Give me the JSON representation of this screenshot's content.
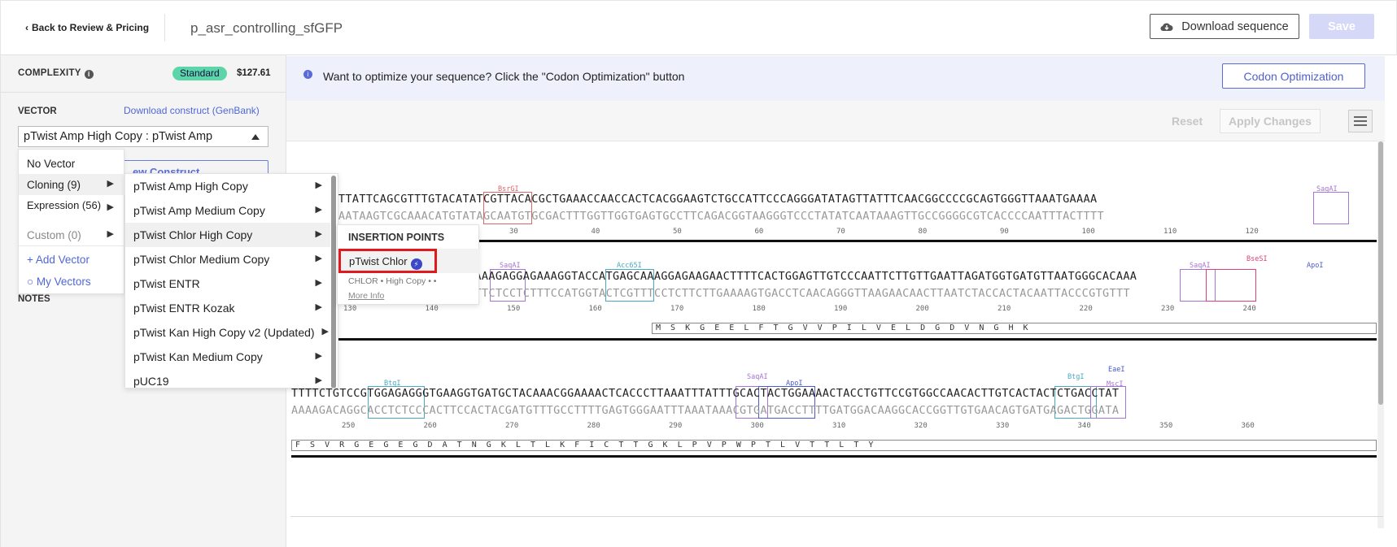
{
  "header": {
    "back_label": "Back to Review & Pricing",
    "sequence_name": "p_asr_controlling_sfGFP",
    "download_label": "Download sequence",
    "save_label": "Save"
  },
  "sidebar": {
    "complexity_label": "COMPLEXITY",
    "complexity_badge": "Standard",
    "price": "$127.61",
    "vector_label": "VECTOR",
    "download_construct_label": "Download construct (GenBank)",
    "vector_selected": "pTwist Amp High Copy : pTwist Amp",
    "new_construct_label": "ew Construct",
    "notes_label": "NOTES"
  },
  "vector_menu": {
    "items": [
      {
        "label": "No Vector"
      },
      {
        "label": "Cloning (9)"
      },
      {
        "label": "Expression (56)"
      },
      {
        "label": "Custom (0)"
      }
    ],
    "add_vector": "Add Vector",
    "my_vectors": "My Vectors"
  },
  "cloning_menu": {
    "items": [
      "pTwist Amp High Copy",
      "pTwist Amp Medium Copy",
      "pTwist Chlor High Copy",
      "pTwist Chlor Medium Copy",
      "pTwist ENTR",
      "pTwist ENTR Kozak",
      "pTwist Kan High Copy v2 (Updated)",
      "pTwist Kan Medium Copy",
      "pUC19"
    ]
  },
  "insertion_popup": {
    "title": "INSERTION POINTS",
    "option": "pTwist Chlor",
    "subtitle": "CHLOR • High Copy • •",
    "more_info": "More Info"
  },
  "banner": {
    "text": "Want to optimize your sequence? Click the \"Codon Optimization\" button",
    "button": "Codon Optimization"
  },
  "toolbar": {
    "reset": "Reset",
    "apply": "Apply Changes"
  },
  "sequence_rows": [
    {
      "fwd": "TAATTTATTCAGCGTTTGTACATATCGTTACACGCTGAAACCAACCACTCACGGAAGTCTGCCATTCCCAGGGATATAGTTATTTCAACGGCCCCGCAGTGGGTTAAATGAAAA",
      "rev": "ATTAAATAAGTCGCAAACATGTATAGCAATGTGCGACTTTGGTTGGTGAGTGCCTTCAGACGGTAAGGGTCCCTATATCAATAAAGTTGCCGGGGCGTCACCCCAATTTACTTTT",
      "ticks": [
        "30",
        "40",
        "50",
        "60",
        "70",
        "80",
        "90",
        "100",
        "110",
        "120"
      ],
      "enzymes": [
        "BsrGI",
        "SaqAI"
      ]
    },
    {
      "fwd": "ATTAAAGAGGAGAAAGGTACCATGAGCAAAGGAGAAGAACTTTTCACTGGAGTTGTCCCAATTCTTGTTGAATTAGATGGTGATGTTAATGGGCACAAA",
      "rev": "TAACTCCCATACTGTGTAATTTCTCCTCTTTCCATGGTACTCGTTTCCTCTTCTTGAAAAGTGACCTCAACAGGGTTAAGAACAACTTAATCTACCACTACAATTACCCGTGTTT",
      "ticks": [
        "130",
        "140",
        "150",
        "160",
        "170",
        "180",
        "190",
        "200",
        "210",
        "220",
        "230",
        "240"
      ],
      "enzymes": [
        "SaqAI",
        "Acc65I",
        "SaqAI",
        "BseSI",
        "ApoI"
      ],
      "protein": "M  S  K  G  E  E  L  F  T  G  V  V  P  I  L  V  E  L  D  G  D  V  N  G  H  K"
    },
    {
      "fwd": "TTTTCTGTCCGTGGAGAGGGTGAAGGTGATGCTACAAACGGAAAACTCACCCTTAAATTTATTTGCACTACTGGAAAACTACCTGTTCCGTGGCCAACACTTGTCACTACTCTGACCTAT",
      "rev": "AAAAGACAGGCACCTCTCCCACTTCCACTACGATGTTTGCCTTTTGAGTGGGAATTTAAATAAACGTGATGACCTTTTGATGGACAAGGCACCGGTTGTGAACAGTGATGAGACTGGATA",
      "ticks": [
        "250",
        "260",
        "270",
        "280",
        "290",
        "300",
        "310",
        "320",
        "330",
        "340",
        "350",
        "360"
      ],
      "enzymes": [
        "BtgI",
        "SaqAI",
        "ApoI",
        "BtgI",
        "EaeI",
        "MscI"
      ],
      "protein": "F  S  V  R  G  E  G  E  G  D  A  T  N  G  K  L  T  L  K  F  I  C  T  T  G  K  L  P  V  P  W  P  T  L  V  T  T  L  T  Y"
    }
  ],
  "colors": {
    "accent": "#5a6ad8",
    "badge": "#5cd6a8",
    "highlight_border": "#e0191f",
    "enzyme_red": "#e06666",
    "enzyme_purple": "#a674d6",
    "enzyme_teal": "#4aa8c0",
    "enzyme_pink": "#e0407a",
    "enzyme_blue": "#4a5ad0"
  }
}
